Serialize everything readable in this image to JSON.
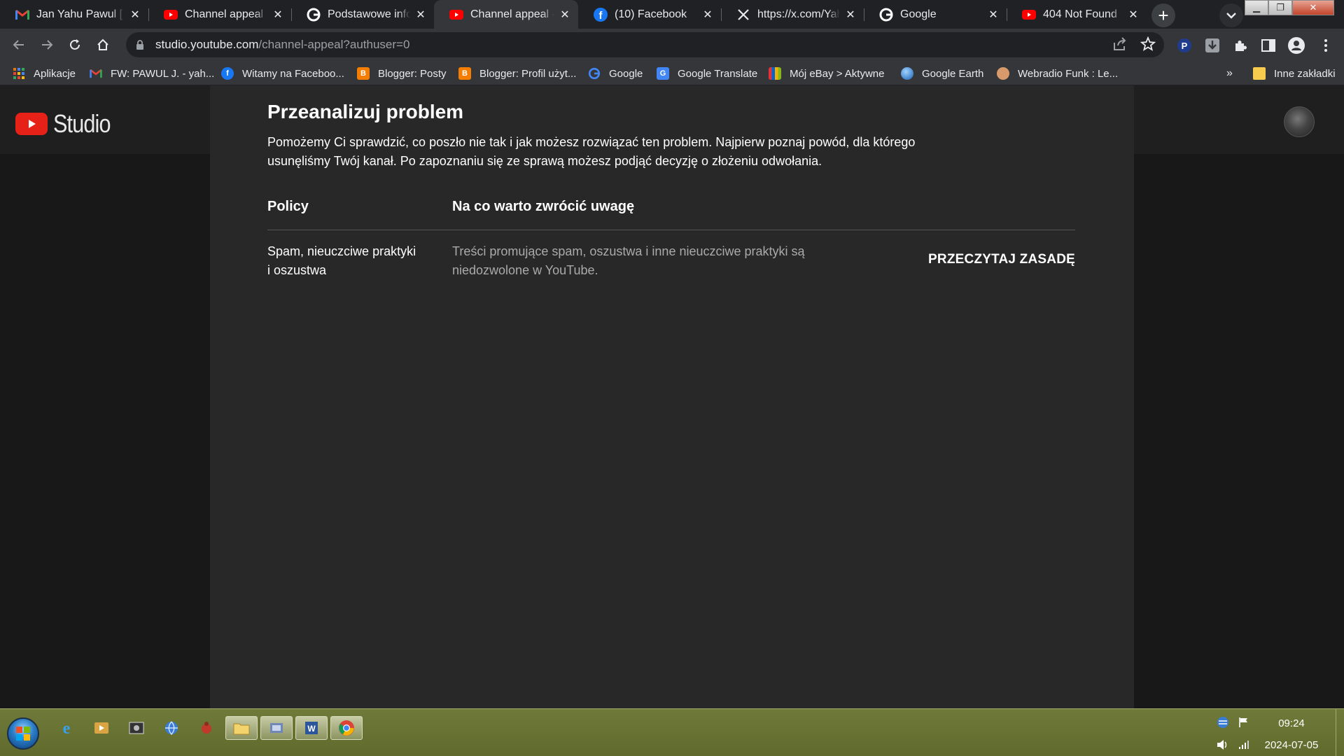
{
  "browser": {
    "tabs": [
      {
        "title": "Jan Yahu Pawul [ yahu",
        "icon": "gmail-icon"
      },
      {
        "title": "Channel appeal - YouTube",
        "icon": "youtube-icon"
      },
      {
        "title": "Podstawowe informacje",
        "icon": "google-icon"
      },
      {
        "title": "Channel appeal - YouTube",
        "icon": "youtube-icon"
      },
      {
        "title": "(10) Facebook",
        "icon": "facebook-icon"
      },
      {
        "title": "https://x.com/Yahu",
        "icon": "x-icon"
      },
      {
        "title": "Google",
        "icon": "google-icon"
      },
      {
        "title": "404 Not Found",
        "icon": "youtube-icon"
      }
    ],
    "active_tab": 3,
    "url_host": "studio.youtube.com",
    "url_path": "/channel-appeal?authuser=0",
    "bookmarks": [
      {
        "label": "Aplikacje",
        "icon": "apps-grid-icon"
      },
      {
        "label": "FW: PAWUL J. - yah...",
        "icon": "gmail-icon"
      },
      {
        "label": "Witamy na Faceboo...",
        "icon": "facebook-icon"
      },
      {
        "label": "Blogger: Posty",
        "icon": "blogger-icon"
      },
      {
        "label": "Blogger: Profil użyt...",
        "icon": "blogger-icon"
      },
      {
        "label": "Google",
        "icon": "google-icon"
      },
      {
        "label": "Google Translate",
        "icon": "translate-icon"
      },
      {
        "label": "Mój eBay > Aktywne",
        "icon": "ebay-icon"
      },
      {
        "label": "Google Earth",
        "icon": "earth-icon"
      },
      {
        "label": "Webradio Funk : Le...",
        "icon": "radio-icon"
      }
    ],
    "overflow_label": "»",
    "other_bookmarks": "Inne zakładki"
  },
  "studio": {
    "logo_text": "Studio",
    "heading": "Przeanalizuj problem",
    "intro": "Pomożemy Ci sprawdzić, co poszło nie tak i jak możesz rozwiązać ten problem. Najpierw poznaj powód, dla którego usunęliśmy Twój kanał. Po zapoznaniu się ze sprawą możesz podjąć decyzję o złożeniu odwołania.",
    "col_policy": "Policy",
    "col_notes": "Na co warto zwrócić uwagę",
    "policy_name": "Spam, nieuczciwe praktyki i oszustwa",
    "policy_desc": "Treści promujące spam, oszustwa i inne nieuczciwe praktyki są niedozwolone w YouTube.",
    "read_button": "PRZECZYTAJ ZASADĘ"
  },
  "taskbar": {
    "time": "09:24",
    "date": "2024-07-05"
  },
  "colors": {
    "page_bg": "#181818",
    "dialog_bg": "#282828",
    "youtube_red": "#e62117",
    "taskbar": "#6f7a3a"
  }
}
